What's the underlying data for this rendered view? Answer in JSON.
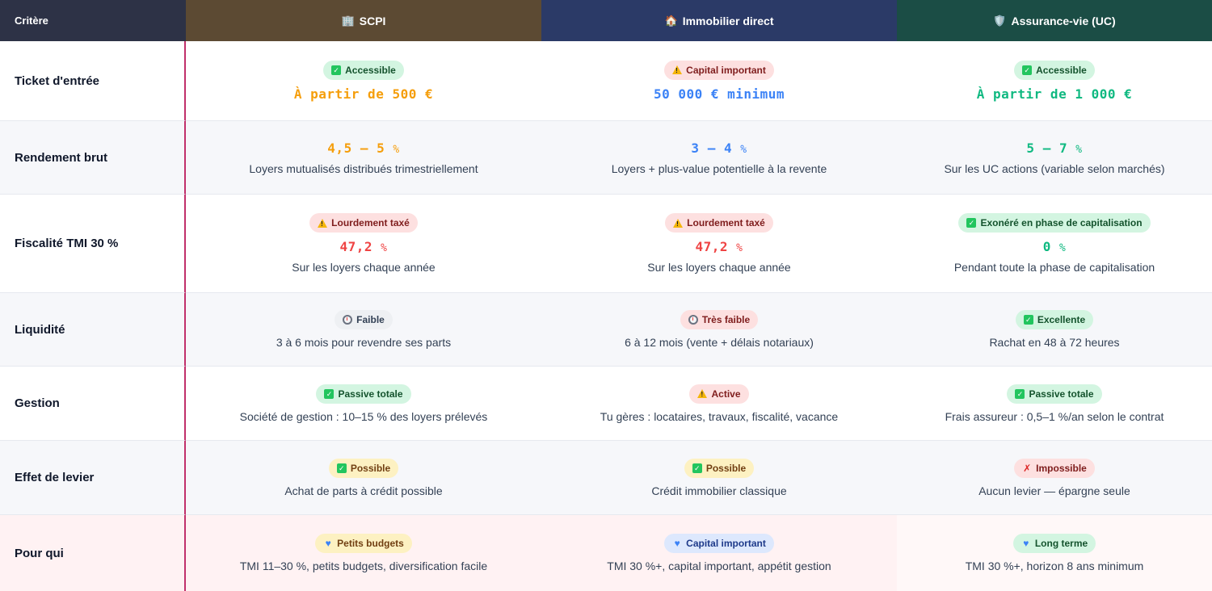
{
  "header": {
    "criteria": "Critère",
    "columns": [
      {
        "label": "SCPI",
        "icon": "building-icon"
      },
      {
        "label": "Immobilier direct",
        "icon": "house-icon"
      },
      {
        "label": "Assurance-vie (UC)",
        "icon": "shield-icon"
      }
    ]
  },
  "rows": [
    {
      "label": "Ticket d'entrée",
      "cells": [
        {
          "badge": "Accessible",
          "badge_icon": "check-icon",
          "value": "À partir de 500 €"
        },
        {
          "badge": "Capital important",
          "badge_icon": "warning-icon",
          "value": "50 000 € minimum"
        },
        {
          "badge": "Accessible",
          "badge_icon": "check-icon",
          "value": "À partir de 1 000 €"
        }
      ]
    },
    {
      "label": "Rendement brut",
      "cells": [
        {
          "value": "4,5 – 5",
          "unit": "%",
          "note": "Loyers mutualisés distribués trimestriellement"
        },
        {
          "value": "3 – 4",
          "unit": "%",
          "note": "Loyers + plus-value potentielle à la revente"
        },
        {
          "value": "5 – 7",
          "unit": "%",
          "note": "Sur les UC actions (variable selon marchés)"
        }
      ]
    },
    {
      "label": "Fiscalité TMI 30 %",
      "cells": [
        {
          "badge": "Lourdement taxé",
          "badge_icon": "warning-icon",
          "value": "47,2",
          "unit": "%",
          "note": "Sur les loyers chaque année"
        },
        {
          "badge": "Lourdement taxé",
          "badge_icon": "warning-icon",
          "value": "47,2",
          "unit": "%",
          "note": "Sur les loyers chaque année"
        },
        {
          "badge": "Exonéré en phase de capitalisation",
          "badge_icon": "check-icon",
          "value": "0",
          "unit": "%",
          "note": "Pendant toute la phase de capitalisation"
        }
      ]
    },
    {
      "label": "Liquidité",
      "cells": [
        {
          "badge": "Faible",
          "badge_icon": "timer-icon",
          "note": "3 à 6 mois pour revendre ses parts"
        },
        {
          "badge": "Très faible",
          "badge_icon": "timer-icon",
          "note": "6 à 12 mois (vente + délais notariaux)"
        },
        {
          "badge": "Excellente",
          "badge_icon": "check-icon",
          "note": "Rachat en 48 à 72 heures"
        }
      ]
    },
    {
      "label": "Gestion",
      "cells": [
        {
          "badge": "Passive totale",
          "badge_icon": "check-icon",
          "note": "Société de gestion : 10–15 % des loyers prélevés"
        },
        {
          "badge": "Active",
          "badge_icon": "warning-icon",
          "note": "Tu gères : locataires, travaux, fiscalité, vacance"
        },
        {
          "badge": "Passive totale",
          "badge_icon": "check-icon",
          "note": "Frais assureur : 0,5–1 %/an selon le contrat"
        }
      ]
    },
    {
      "label": "Effet de levier",
      "cells": [
        {
          "badge": "Possible",
          "badge_icon": "check-icon",
          "note": "Achat de parts à crédit possible"
        },
        {
          "badge": "Possible",
          "badge_icon": "check-icon",
          "note": "Crédit immobilier classique"
        },
        {
          "badge": "Impossible",
          "badge_icon": "x-icon",
          "note": "Aucun levier — épargne seule"
        }
      ]
    },
    {
      "label": "Pour qui",
      "cells": [
        {
          "badge": "Petits budgets",
          "badge_icon": "heart-icon",
          "note": "TMI 11–30 %, petits budgets, diversification facile"
        },
        {
          "badge": "Capital important",
          "badge_icon": "heart-icon",
          "note": "TMI 30 %+, capital important, appétit gestion"
        },
        {
          "badge": "Long terme",
          "badge_icon": "heart-icon",
          "note": "TMI 30 %+, horizon 8 ans minimum"
        }
      ]
    }
  ],
  "colors": {
    "orange": "#f59e0b",
    "blue": "#3b82f6",
    "green": "#10b981",
    "red": "#ef4444",
    "accent_border": "#c1306b"
  }
}
